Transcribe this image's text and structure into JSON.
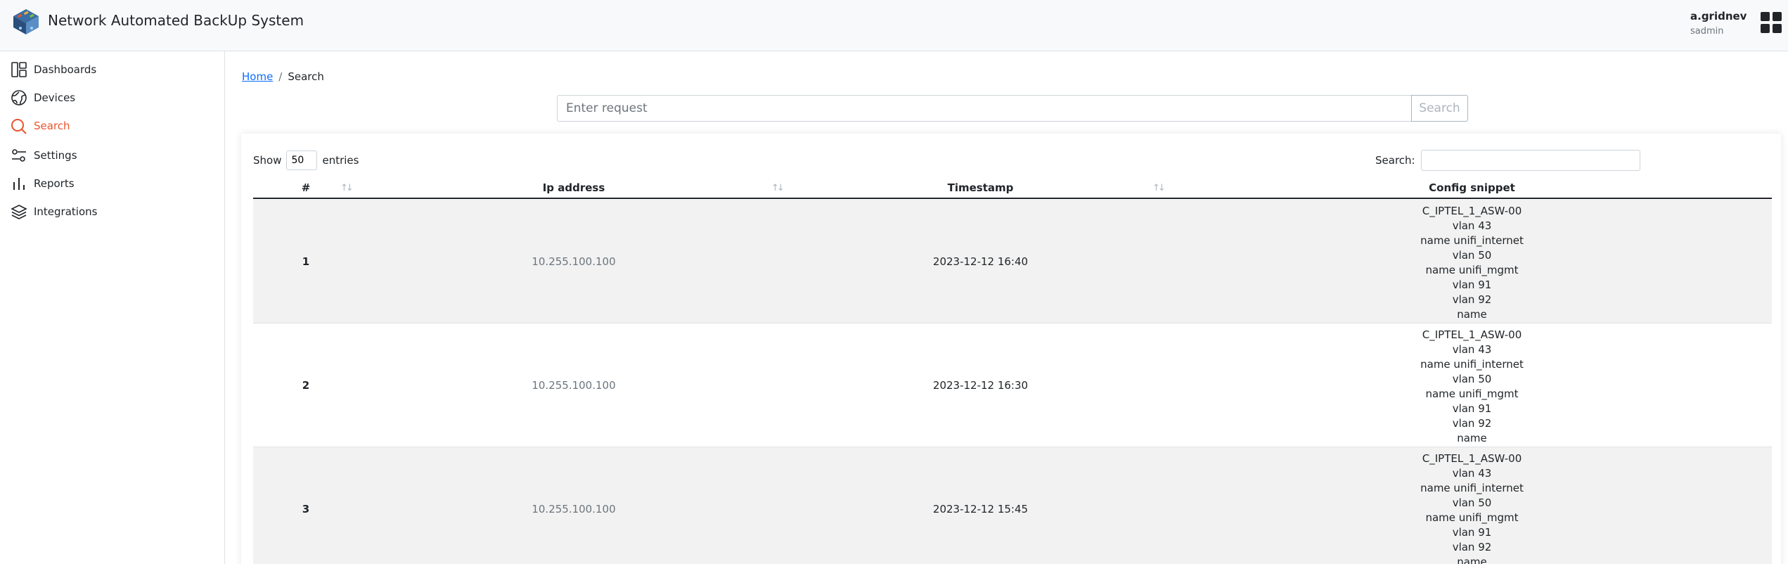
{
  "app": {
    "title": "Network Automated BackUp System"
  },
  "user": {
    "name": "a.gridnev",
    "role": "sadmin"
  },
  "sidebar": {
    "items": [
      {
        "label": "Dashboards",
        "icon": "dashboard-icon"
      },
      {
        "label": "Devices",
        "icon": "globe-icon"
      },
      {
        "label": "Search",
        "icon": "search-icon",
        "active": true
      },
      {
        "label": "Settings",
        "icon": "settings-sliders-icon"
      },
      {
        "label": "Reports",
        "icon": "bar-chart-icon"
      },
      {
        "label": "Integrations",
        "icon": "layers-icon"
      }
    ]
  },
  "breadcrumb": {
    "home": "Home",
    "separator": "/",
    "current": "Search"
  },
  "request": {
    "placeholder": "Enter request",
    "button": "Search"
  },
  "table_controls": {
    "show_label": "Show",
    "entries_value": "50",
    "entries_label": "entries",
    "search_label": "Search:"
  },
  "table": {
    "headers": {
      "num": "#",
      "ip": "Ip address",
      "timestamp": "Timestamp",
      "snippet": "Config snippet"
    },
    "rows": [
      {
        "num": "1",
        "ip": "10.255.100.100",
        "timestamp": "2023-12-12 16:40",
        "snippet": [
          "C_IPTEL_1_ASW-00",
          "vlan 43",
          "name unifi_internet",
          "vlan 50",
          "name unifi_mgmt",
          "vlan 91",
          "vlan 92",
          "name"
        ]
      },
      {
        "num": "2",
        "ip": "10.255.100.100",
        "timestamp": "2023-12-12 16:30",
        "snippet": [
          "C_IPTEL_1_ASW-00",
          "vlan 43",
          "name unifi_internet",
          "vlan 50",
          "name unifi_mgmt",
          "vlan 91",
          "vlan 92",
          "name"
        ]
      },
      {
        "num": "3",
        "ip": "10.255.100.100",
        "timestamp": "2023-12-12 15:45",
        "snippet": [
          "C_IPTEL_1_ASW-00",
          "vlan 43",
          "name unifi_internet",
          "vlan 50",
          "name unifi_mgmt",
          "vlan 91",
          "vlan 92",
          "name"
        ]
      }
    ]
  },
  "colors": {
    "accent": "#e8542f",
    "link": "#0d6efd",
    "header_bg": "#f8f9fa",
    "stripe": "#f2f2f2"
  }
}
